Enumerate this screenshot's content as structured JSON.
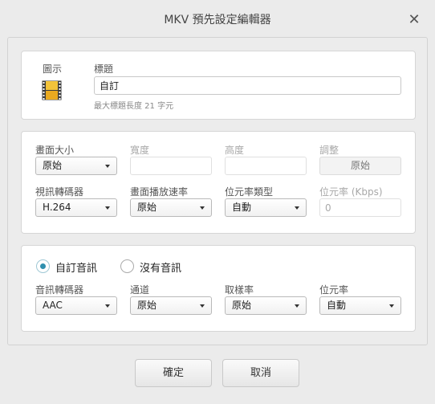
{
  "window": {
    "title": "MKV 預先設定編輯器",
    "close_symbol": "✕"
  },
  "header_panel": {
    "icon_label": "圖示",
    "icon_name": "film-icon",
    "title_label": "標題",
    "title_value": "自訂",
    "title_hint": "最大標題長度 21 字元"
  },
  "video_panel": {
    "frame_size_label": "畫面大小",
    "frame_size_value": "原始",
    "width_label": "寬度",
    "width_value": "",
    "height_label": "高度",
    "height_value": "",
    "adjust_label": "調整",
    "adjust_button": "原始",
    "video_codec_label": "視訊轉碼器",
    "video_codec_value": "H.264",
    "frame_rate_label": "畫面播放速率",
    "frame_rate_value": "原始",
    "bitrate_type_label": "位元率類型",
    "bitrate_type_value": "自動",
    "bitrate_kbps_label": "位元率 (Kbps)",
    "bitrate_kbps_value": "0"
  },
  "audio_panel": {
    "custom_audio_label": "自訂音訊",
    "no_audio_label": "沒有音訊",
    "selected": "custom",
    "audio_codec_label": "音訊轉碼器",
    "audio_codec_value": "AAC",
    "channel_label": "通道",
    "channel_value": "原始",
    "sample_rate_label": "取樣率",
    "sample_rate_value": "原始",
    "bitrate_label": "位元率",
    "bitrate_value": "自動"
  },
  "footer": {
    "ok_label": "確定",
    "cancel_label": "取消"
  }
}
